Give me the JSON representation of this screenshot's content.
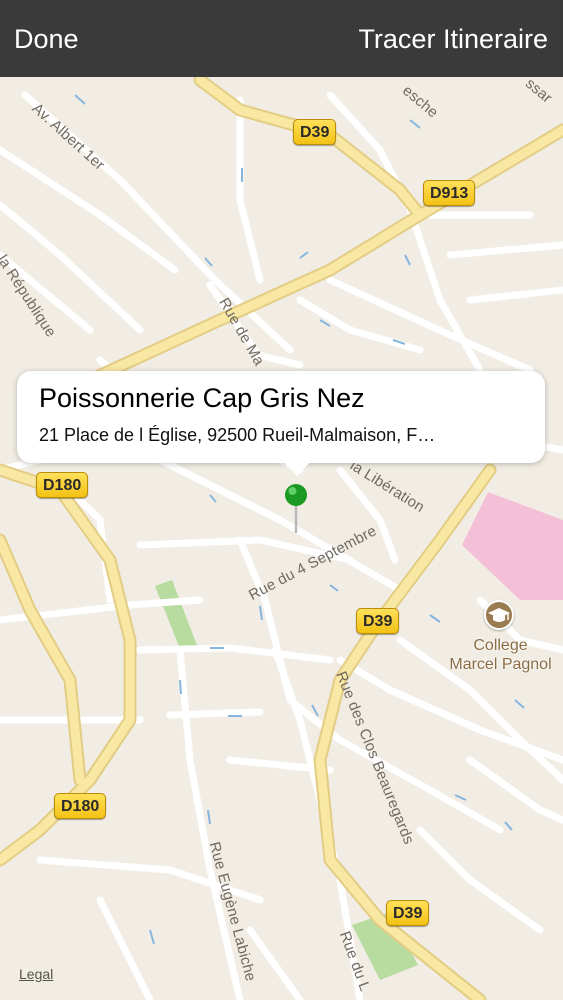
{
  "navbar": {
    "done_label": "Done",
    "route_label": "Tracer Itineraire"
  },
  "callout": {
    "title": "Poissonnerie Cap Gris Nez",
    "subtitle": "21 Place de l Église, 92500 Rueil-Malmaison, F…"
  },
  "map": {
    "road_shields": [
      "D39",
      "D913",
      "D180",
      "D39",
      "D180",
      "D39"
    ],
    "streets": [
      "Av. Albert 1er",
      "la République",
      "Rue de Ma",
      "Rue du 4 Septembre",
      "la Libération",
      "Rue des Clos Beauregards",
      "Rue Eugène Labiche",
      "Rue du L",
      "esche",
      "ssar"
    ],
    "poi": {
      "label_line1": "College",
      "label_line2": "Marcel Pagnol",
      "icon": "graduation-cap-icon"
    },
    "legal_label": "Legal"
  },
  "colors": {
    "navbar_bg": "#3a3a3a",
    "map_bg": "#f1ede4",
    "major_road": "#f6e49a",
    "shield_yellow": "#f3c215",
    "pin_green": "#1a9a22",
    "pink_area": "#f4c0d8",
    "park_green": "#b8dca0"
  }
}
